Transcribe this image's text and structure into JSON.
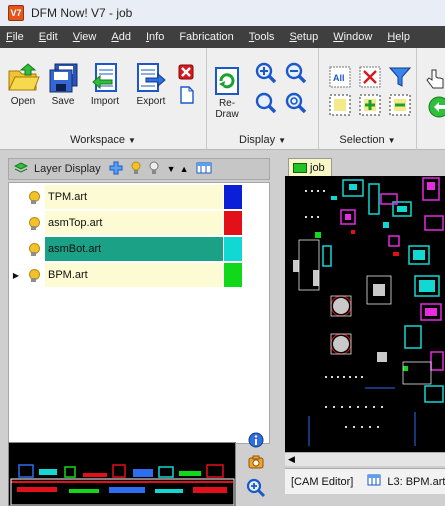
{
  "window": {
    "title": "DFM Now! V7 - job",
    "app_icon_text": "V7"
  },
  "menu": [
    {
      "accel": "F",
      "rest": "ile"
    },
    {
      "accel": "E",
      "rest": "dit"
    },
    {
      "accel": "V",
      "rest": "iew"
    },
    {
      "accel": "A",
      "rest": "dd"
    },
    {
      "accel": "I",
      "rest": "nfo"
    },
    {
      "accel": "",
      "rest": "Fabrication"
    },
    {
      "accel": "T",
      "rest": "ools"
    },
    {
      "accel": "S",
      "rest": "etup"
    },
    {
      "accel": "W",
      "rest": "indow"
    },
    {
      "accel": "H",
      "rest": "elp"
    }
  ],
  "ribbon": {
    "workspace": {
      "label": "Workspace",
      "buttons": [
        {
          "label": "Open",
          "icon": "folder-open-icon"
        },
        {
          "label": "Save",
          "icon": "save-icon"
        },
        {
          "label": "Import",
          "icon": "import-icon"
        },
        {
          "label": "Export",
          "icon": "export-icon"
        }
      ],
      "close_icon": "close-icon",
      "new_icon": "new-document-icon"
    },
    "display": {
      "label": "Display",
      "redraw_label_1": "Re-",
      "redraw_label_2": "Draw"
    },
    "selection": {
      "label": "Selection"
    }
  },
  "layer_panel": {
    "title": "Layer Display",
    "layers": [
      {
        "name": "TPM.art",
        "color": "#0a1fd6",
        "row_bg": "#fdfbd3",
        "selected": false,
        "current": false
      },
      {
        "name": "asmTop.art",
        "color": "#e3101a",
        "row_bg": "#fdfbd3",
        "selected": false,
        "current": false
      },
      {
        "name": "asmBot.art",
        "color": "#12d8d4",
        "row_bg": "#1ba286",
        "selected": true,
        "current": false
      },
      {
        "name": "BPM.art",
        "color": "#12d81c",
        "row_bg": "#fdfbd3",
        "selected": false,
        "current": true
      }
    ]
  },
  "main": {
    "tab_label": "job",
    "status": {
      "mode": "[CAM Editor]",
      "layer": "L3: BPM.art"
    }
  },
  "colors": {
    "menubar": "#3f3f3f",
    "tab_bg": "#f8f7c8",
    "selected_row": "#1ba286"
  }
}
